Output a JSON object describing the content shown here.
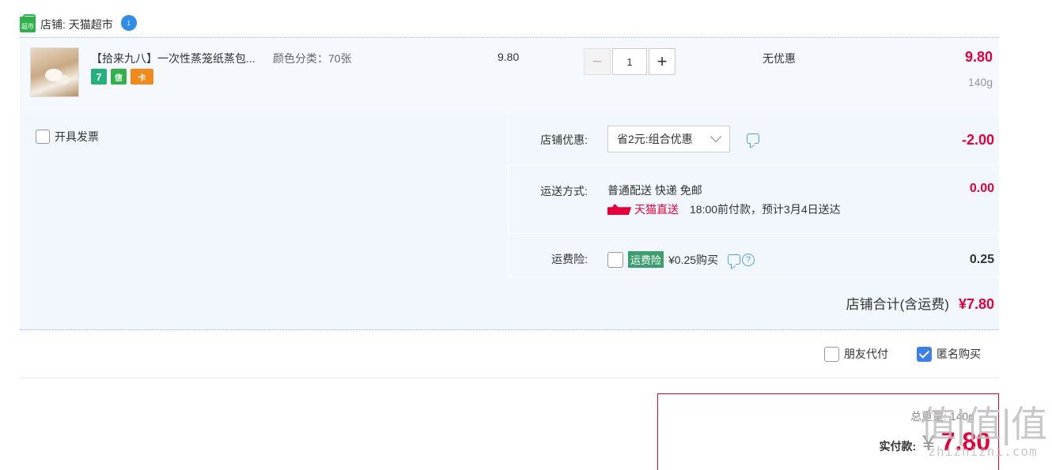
{
  "shop": {
    "logo_text": "超市",
    "label": "店铺: 天猫超市",
    "ww_badge": "1"
  },
  "item": {
    "title": "【拾来九八】一次性蒸笼纸蒸包...",
    "sku": "颜色分类：70张",
    "tags": [
      "7",
      "信",
      "卡"
    ],
    "unit_price": "9.80",
    "qty": "1",
    "minus": "−",
    "plus": "+",
    "discount": "无优惠",
    "total": "9.80",
    "weight": "140g"
  },
  "invoice": {
    "label": "开具发票"
  },
  "coupon": {
    "label": "店铺优惠:",
    "selected": "省2元:组合优惠",
    "amount": "-2.00"
  },
  "shipping": {
    "label": "运送方式:",
    "method": "普通配送 快递 免邮",
    "badge": "天猫直送",
    "time": "18:00前付款，预计3月4日送达",
    "amount": "0.00"
  },
  "insurance": {
    "label": "运费险:",
    "tag": "运费险",
    "price": "¥0.25购买",
    "help": "?",
    "amount": "0.25"
  },
  "shop_total": {
    "label": "店铺合计(含运费)",
    "amount": "¥7.80"
  },
  "pay_options": [
    {
      "label": "朋友代付",
      "checked": false
    },
    {
      "label": "匿名购买",
      "checked": true
    }
  ],
  "summary": {
    "weight": "总重量: 140g",
    "pay_label": "实付款:",
    "yen": "¥",
    "amount": "7.80"
  },
  "watermark": {
    "big": "值|值|值",
    "small": "zhizhizhi.com"
  },
  "colors": {
    "price_red": "#e4003b",
    "bg_blue": "#f2f7fe",
    "accent_blue": "#3a80e8",
    "green": "#2db24a"
  }
}
